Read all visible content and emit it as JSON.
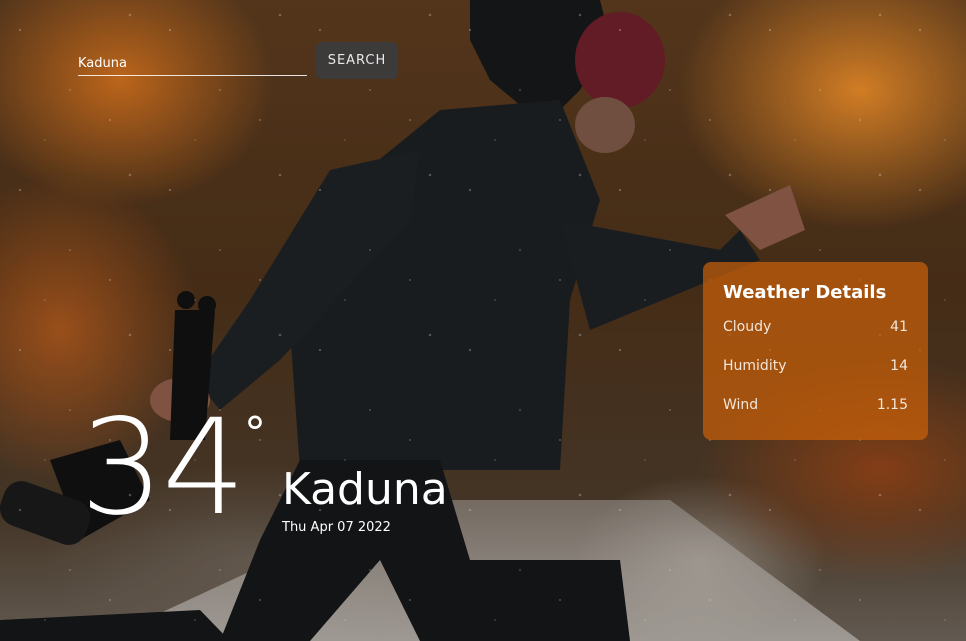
{
  "search": {
    "value": "Kaduna",
    "button_label": "SEARCH"
  },
  "current": {
    "temperature": "34",
    "degree_symbol": "°",
    "city": "Kaduna",
    "date": "Thu Apr 07 2022"
  },
  "details": {
    "title": "Weather Details",
    "rows": [
      {
        "label": "Cloudy",
        "value": "41"
      },
      {
        "label": "Humidity",
        "value": "14"
      },
      {
        "label": "Wind",
        "value": "1.15"
      }
    ]
  },
  "colors": {
    "panel": "#c85f0a",
    "button": "#3d3a3a"
  }
}
